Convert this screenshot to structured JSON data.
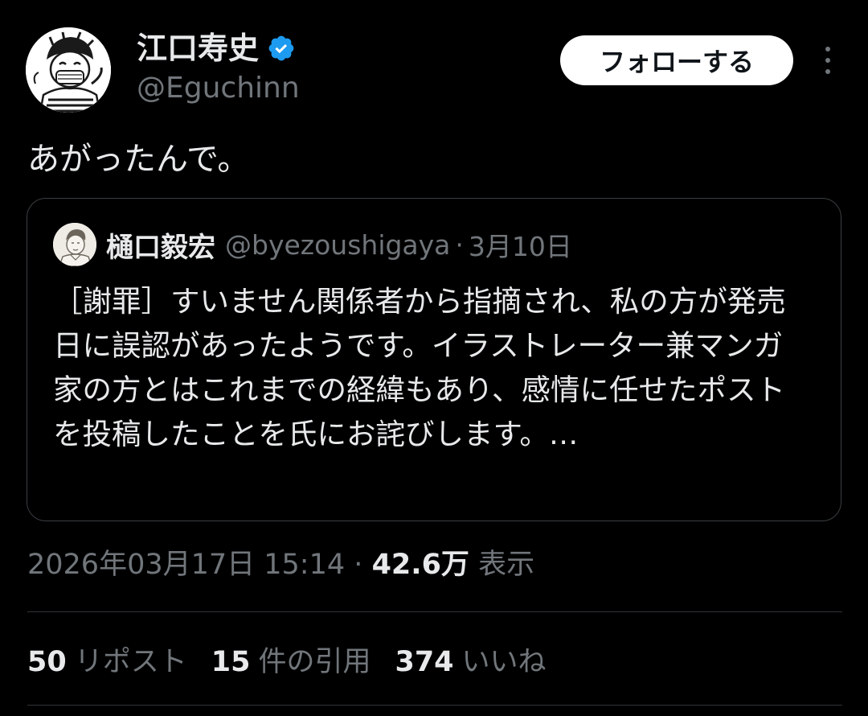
{
  "author": {
    "display_name": "江口寿史",
    "handle": "@Eguchinn",
    "verified_color": "#1d9bf0"
  },
  "follow_label": "フォローする",
  "tweet_text": "あがったんで。",
  "quote": {
    "display_name": "樋口毅宏",
    "handle": "@byezoushigaya",
    "separator": "·",
    "date": "3月10日",
    "text": "［謝罪］すいません関係者から指摘され、私の方が発売日に誤認があったようです。イラストレーター兼マンガ家の方とはこれまでの経緯もあり、感情に任せたポストを投稿したことを氏にお詫びします。…"
  },
  "meta": {
    "timestamp": "2026年03月17日 15:14",
    "separator": "·",
    "views_count": "42.6万",
    "views_label": "表示"
  },
  "stats": {
    "reposts_count": "50",
    "reposts_label": "リポスト",
    "quotes_count": "15",
    "quotes_label": "件の引用",
    "likes_count": "374",
    "likes_label": "いいね"
  }
}
